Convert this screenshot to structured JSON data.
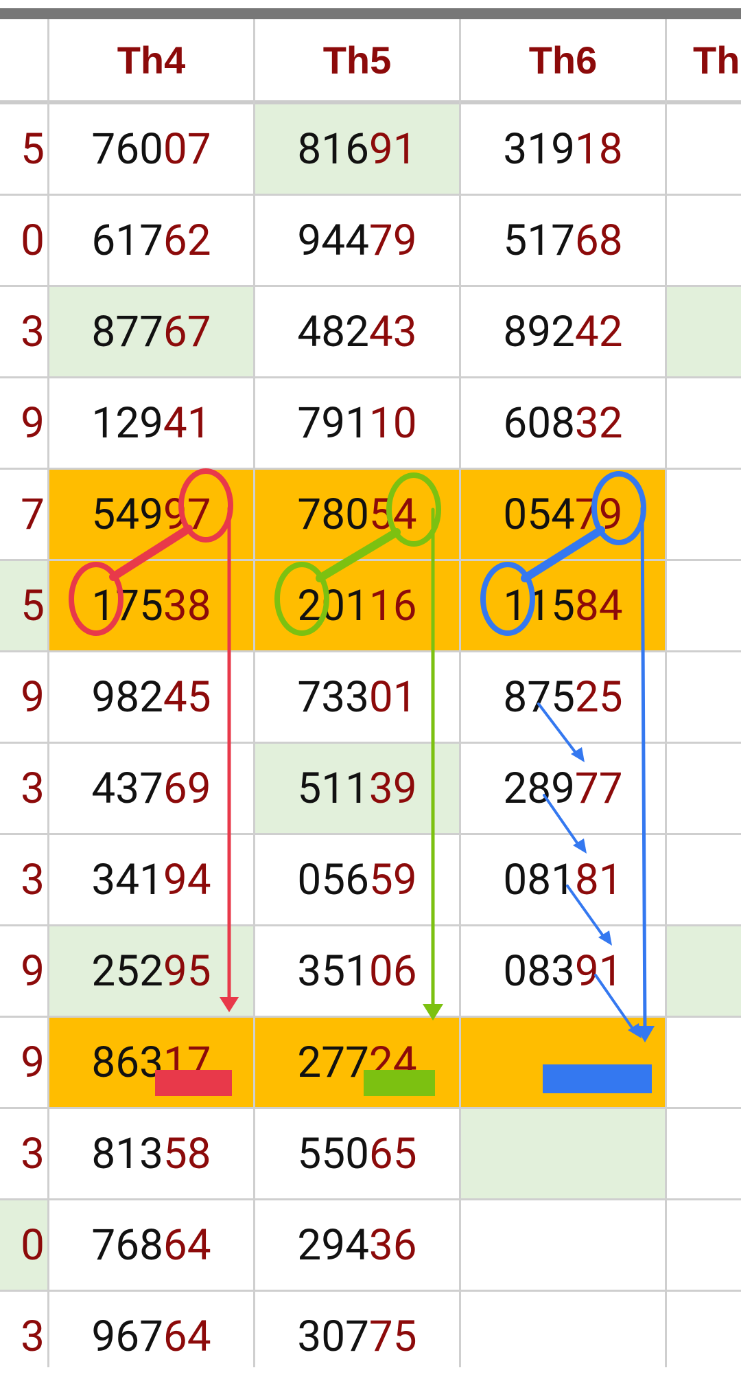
{
  "columns": [
    {
      "key": "prev",
      "label": ""
    },
    {
      "key": "th4",
      "label": "Th4"
    },
    {
      "key": "th5",
      "label": "Th5"
    },
    {
      "key": "th6",
      "label": "Th6"
    },
    {
      "key": "th7",
      "label": "Th"
    }
  ],
  "rows": [
    {
      "prev": {
        "tail": "5",
        "bg": "white"
      },
      "th4": {
        "head": "760",
        "tail": "07",
        "bg": "white"
      },
      "th5": {
        "head": "816",
        "tail": "91",
        "bg": "green"
      },
      "th6": {
        "head": "319",
        "tail": "18",
        "bg": "white"
      },
      "th7": {
        "bg": "white"
      }
    },
    {
      "prev": {
        "tail": "0",
        "bg": "white"
      },
      "th4": {
        "head": "617",
        "tail": "62",
        "bg": "white"
      },
      "th5": {
        "head": "944",
        "tail": "79",
        "bg": "white"
      },
      "th6": {
        "head": "517",
        "tail": "68",
        "bg": "white"
      },
      "th7": {
        "bg": "white"
      }
    },
    {
      "prev": {
        "tail": "3",
        "bg": "white"
      },
      "th4": {
        "head": "877",
        "tail": "67",
        "bg": "green"
      },
      "th5": {
        "head": "482",
        "tail": "43",
        "bg": "white"
      },
      "th6": {
        "head": "892",
        "tail": "42",
        "bg": "white"
      },
      "th7": {
        "bg": "green"
      }
    },
    {
      "prev": {
        "tail": "9",
        "bg": "white"
      },
      "th4": {
        "head": "129",
        "tail": "41",
        "bg": "white"
      },
      "th5": {
        "head": "791",
        "tail": "10",
        "bg": "white"
      },
      "th6": {
        "head": "608",
        "tail": "32",
        "bg": "white"
      },
      "th7": {
        "bg": "white"
      }
    },
    {
      "prev": {
        "tail": "7",
        "bg": "white"
      },
      "th4": {
        "head": "549",
        "tail": "97",
        "bg": "orange"
      },
      "th5": {
        "head": "780",
        "tail": "54",
        "bg": "orange"
      },
      "th6": {
        "head": "054",
        "tail": "79",
        "bg": "orange"
      },
      "th7": {
        "bg": "white"
      }
    },
    {
      "prev": {
        "tail": "5",
        "bg": "green"
      },
      "th4": {
        "head": "175",
        "tail": "38",
        "bg": "orange"
      },
      "th5": {
        "head": "201",
        "tail": "16",
        "bg": "orange"
      },
      "th6": {
        "head": "115",
        "tail": "84",
        "bg": "orange"
      },
      "th7": {
        "bg": "white"
      }
    },
    {
      "prev": {
        "tail": "9",
        "bg": "white"
      },
      "th4": {
        "head": "982",
        "tail": "45",
        "bg": "white"
      },
      "th5": {
        "head": "733",
        "tail": "01",
        "bg": "white"
      },
      "th6": {
        "head": "875",
        "tail": "25",
        "bg": "white"
      },
      "th7": {
        "bg": "white"
      }
    },
    {
      "prev": {
        "tail": "3",
        "bg": "white"
      },
      "th4": {
        "head": "437",
        "tail": "69",
        "bg": "white"
      },
      "th5": {
        "head": "511",
        "tail": "39",
        "bg": "green"
      },
      "th6": {
        "head": "289",
        "tail": "77",
        "bg": "white"
      },
      "th7": {
        "bg": "white"
      }
    },
    {
      "prev": {
        "tail": "3",
        "bg": "white"
      },
      "th4": {
        "head": "341",
        "tail": "94",
        "bg": "white"
      },
      "th5": {
        "head": "056",
        "tail": "59",
        "bg": "white"
      },
      "th6": {
        "head": "081",
        "tail": "81",
        "bg": "white"
      },
      "th7": {
        "bg": "white"
      }
    },
    {
      "prev": {
        "tail": "9",
        "bg": "white"
      },
      "th4": {
        "head": "252",
        "tail": "95",
        "bg": "green"
      },
      "th5": {
        "head": "351",
        "tail": "06",
        "bg": "white"
      },
      "th6": {
        "head": "083",
        "tail": "91",
        "bg": "white"
      },
      "th7": {
        "bg": "green"
      }
    },
    {
      "prev": {
        "tail": "9",
        "bg": "white"
      },
      "th4": {
        "head": "863",
        "tail": "17",
        "bg": "orange"
      },
      "th5": {
        "head": "277",
        "tail": "24",
        "bg": "orange"
      },
      "th6": {
        "head": "",
        "tail": "",
        "bg": "orange"
      },
      "th7": {
        "bg": "white"
      }
    },
    {
      "prev": {
        "tail": "3",
        "bg": "white"
      },
      "th4": {
        "head": "813",
        "tail": "58",
        "bg": "white"
      },
      "th5": {
        "head": "550",
        "tail": "65",
        "bg": "white"
      },
      "th6": {
        "head": "",
        "tail": "",
        "bg": "green"
      },
      "th7": {
        "bg": "white"
      }
    },
    {
      "prev": {
        "tail": "0",
        "bg": "green"
      },
      "th4": {
        "head": "768",
        "tail": "64",
        "bg": "white"
      },
      "th5": {
        "head": "294",
        "tail": "36",
        "bg": "white"
      },
      "th6": {
        "head": "",
        "tail": "",
        "bg": "white"
      },
      "th7": {
        "bg": "white"
      }
    },
    {
      "prev": {
        "tail": "3",
        "bg": "white"
      },
      "th4": {
        "head": "967",
        "tail": "64",
        "bg": "white"
      },
      "th5": {
        "head": "307",
        "tail": "75",
        "bg": "white"
      },
      "th6": {
        "head": "",
        "tail": "",
        "bg": "white"
      },
      "th7": {
        "bg": "white"
      }
    }
  ],
  "colors": {
    "header_text": "#8c0a0a",
    "tail_text": "#8c0a0a",
    "highlight_orange": "#ffbd00",
    "highlight_green": "#e2f0db",
    "annotation_red": "#e8394a",
    "annotation_green": "#7cc111",
    "annotation_blue": "#3478f0"
  }
}
